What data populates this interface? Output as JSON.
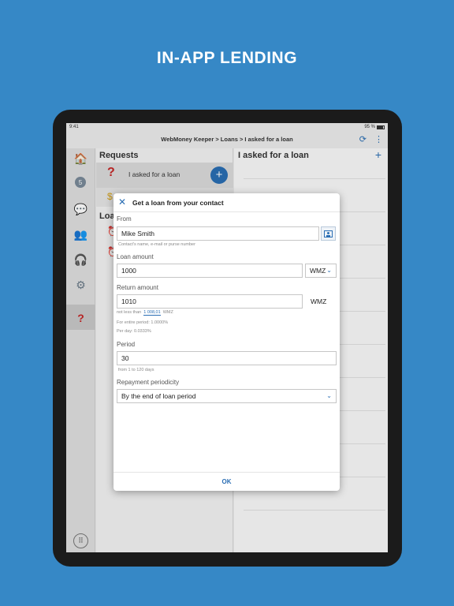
{
  "headline": "IN-APP LENDING",
  "status": {
    "time": "9:41",
    "battery": "95 %"
  },
  "breadcrumb": "WebMoney Keeper > Loans > I asked for a loan",
  "sidebar": {
    "items": [
      {
        "icon": "home-icon",
        "glyph": "🏠"
      },
      {
        "icon": "wallet-icon",
        "glyph": "5"
      },
      {
        "icon": "chat-icon",
        "glyph": "💬"
      },
      {
        "icon": "contacts-icon",
        "glyph": "👥"
      },
      {
        "icon": "support-icon",
        "glyph": "🎧"
      },
      {
        "icon": "settings-icon",
        "glyph": "⚙"
      },
      {
        "icon": "loans-icon",
        "glyph": "?"
      }
    ]
  },
  "requests": {
    "title": "Requests",
    "item_label": "I asked for a loan",
    "add": "+",
    "loans_title_partial": "Loa"
  },
  "right_pane": {
    "title": "I asked for a loan",
    "add": "+"
  },
  "dialog": {
    "title": "Get a loan from your contact",
    "from_label": "From",
    "from_value": "Mike Smith",
    "from_hint": "Contact's name, e-mail or purse number",
    "loan_amount_label": "Loan amount",
    "loan_amount_value": "1000",
    "loan_currency": "WMZ",
    "return_amount_label": "Return amount",
    "return_amount_value": "1010",
    "return_currency": "WMZ",
    "not_less_than": "not less than",
    "min_value": "1 008,01",
    "min_currency": "WMZ",
    "entire_period": "For entire period: 1.0000%",
    "per_day": "Per day: 0.0333%",
    "period_label": "Period",
    "period_value": "30",
    "period_hint": "from 1 to 120 days",
    "periodicity_label": "Repayment periodicity",
    "periodicity_value": "By the end of loan period",
    "ok": "OK"
  }
}
